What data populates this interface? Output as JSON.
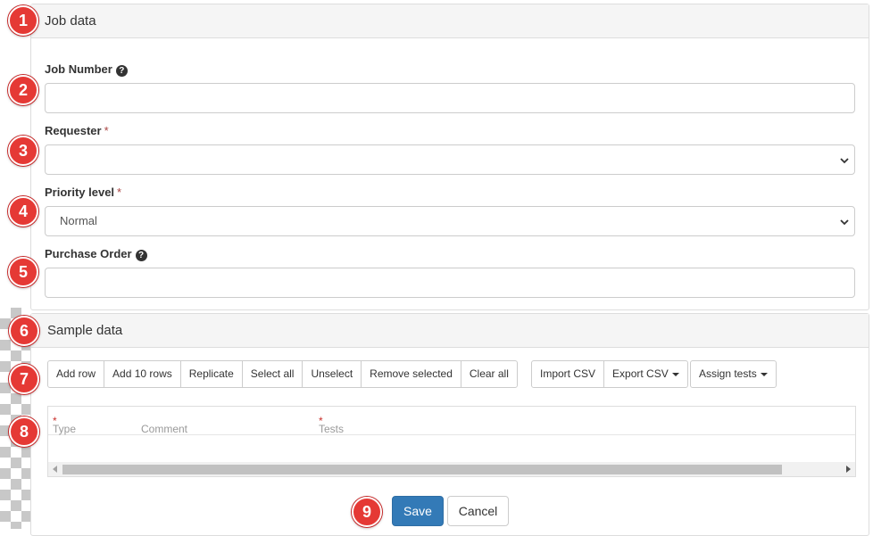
{
  "job_panel": {
    "title": "Job data",
    "fields": {
      "job_number": {
        "label": "Job Number",
        "value": ""
      },
      "requester": {
        "label": "Requester",
        "required_mark": "*",
        "value": ""
      },
      "priority": {
        "label": "Priority level",
        "required_mark": "*",
        "value": "Normal"
      },
      "purchase_order": {
        "label": "Purchase Order",
        "value": ""
      }
    },
    "help_icon_glyph": "?"
  },
  "sample_panel": {
    "title": "Sample data",
    "toolbar": {
      "add_row": "Add row",
      "add_10_rows": "Add 10 rows",
      "replicate": "Replicate",
      "select_all": "Select all",
      "unselect": "Unselect",
      "remove_selected": "Remove selected",
      "clear_all": "Clear all",
      "import_csv": "Import CSV",
      "export_csv": "Export CSV",
      "assign_tests": "Assign tests"
    },
    "grid": {
      "columns": [
        {
          "label": "Type",
          "required_mark": "*"
        },
        {
          "label": "Comment",
          "required_mark": ""
        },
        {
          "label": "Tests",
          "required_mark": "*"
        }
      ]
    }
  },
  "actions": {
    "save": "Save",
    "cancel": "Cancel"
  },
  "callouts": [
    "1",
    "2",
    "3",
    "4",
    "5",
    "6",
    "7",
    "8",
    "9"
  ],
  "colors": {
    "primary": "#337ab7",
    "callout": "#e53935",
    "required": "#a94442"
  }
}
